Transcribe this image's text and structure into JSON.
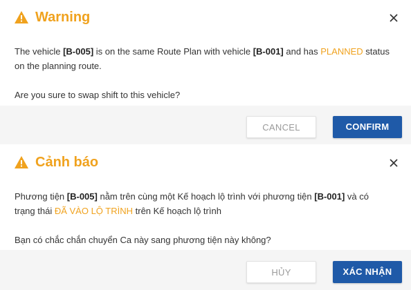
{
  "colors": {
    "warning_accent": "#f0a21e",
    "primary_button": "#1f5aa8",
    "footer_background": "#f5f5f5"
  },
  "dialog_en": {
    "icon": "warning-triangle-icon",
    "title": "Warning",
    "line1_prefix": "The vehicle ",
    "vehicle_a": "[B-005]",
    "line1_middle": " is on the same Route Plan with vehicle ",
    "vehicle_b": "[B-001]",
    "line1_and": " and has ",
    "status": "PLANNED",
    "line1_suffix": " status on the planning route.",
    "question": "Are you sure to swap shift to this vehicle?",
    "cancel_label": "CANCEL",
    "confirm_label": "CONFIRM"
  },
  "dialog_vi": {
    "icon": "warning-triangle-icon",
    "title": "Cảnh báo",
    "line1_prefix": "Phương tiện ",
    "vehicle_a": "[B-005]",
    "line1_middle": " nằm trên cùng một Kế hoạch lộ trình với phương tiện ",
    "vehicle_b": "[B-001]",
    "line1_and": " và có trạng thái ",
    "status": "ĐÃ VÀO LỘ TRÌNH",
    "line1_suffix": " trên Kế hoạch lộ trình",
    "question": "Bạn có chắc chắn chuyển Ca này sang phương tiện này không?",
    "cancel_label": "HỦY",
    "confirm_label": "XÁC NHẬN"
  }
}
